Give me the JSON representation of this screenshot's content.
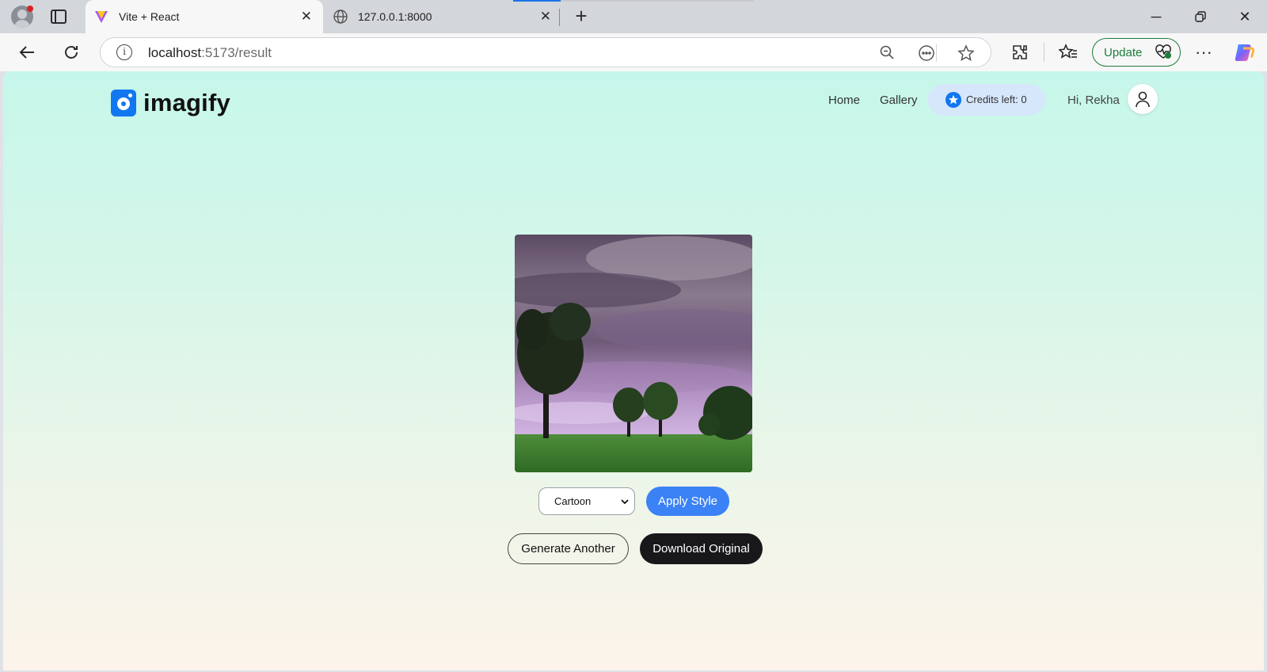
{
  "browser": {
    "tabs": [
      {
        "title": "Vite + React",
        "active": true
      },
      {
        "title": "127.0.0.1:8000",
        "active": false
      }
    ],
    "address": {
      "host": "localhost",
      "path": ":5173/result"
    },
    "update_label": "Update"
  },
  "app": {
    "logo_text": "imagify",
    "nav": {
      "home": "Home",
      "gallery": "Gallery"
    },
    "credits_label": "Credits left: 0",
    "greeting": "Hi, Rekha",
    "style_select": {
      "selected": "Cartoon"
    },
    "buttons": {
      "apply": "Apply Style",
      "generate": "Generate Another",
      "download": "Download Original"
    }
  },
  "colors": {
    "brand_blue": "#1177f0",
    "apply_button": "#3b82f6",
    "download_button": "#18181b",
    "credits_pill": "#d6e6fb",
    "update_green": "#1e7d3b"
  },
  "icons": [
    "profile-icon",
    "tabs-icon",
    "vite-icon",
    "globe-icon",
    "close-icon",
    "plus-icon",
    "minimize-icon",
    "restore-icon",
    "back-icon",
    "reload-icon",
    "info-icon",
    "zoom-out-icon",
    "reading-mode-icon",
    "star-icon",
    "extensions-icon",
    "favorites-icon",
    "more-icon",
    "copilot-icon",
    "user-icon",
    "chevron-down-icon"
  ]
}
